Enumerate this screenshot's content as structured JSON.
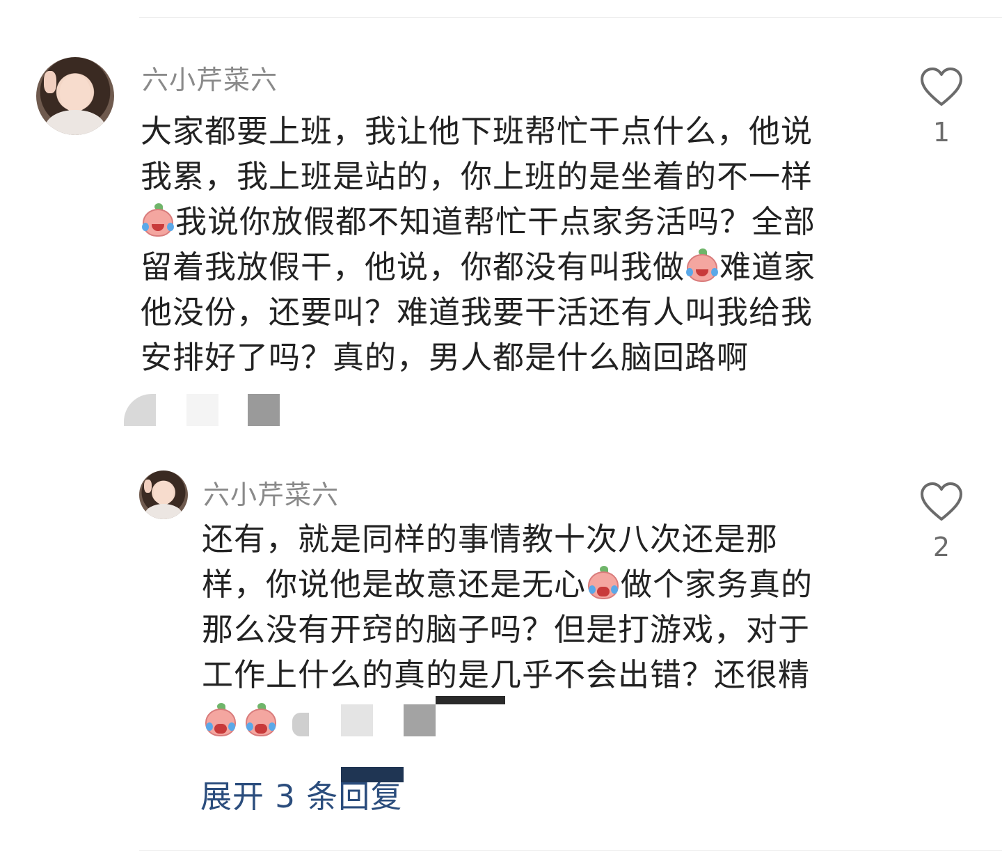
{
  "comments": [
    {
      "username": "六小芹菜六",
      "text_parts": [
        "大家都要上班，我让他下班帮忙干点什么，他说\n我累，我上班是站的，你上班的是坐着的不一样\n",
        "我说你放假都不知道帮忙干点家务活吗？全部\n留着我放假干，他说，你都没有叫我做",
        "难道家\n他没份，还要叫？难道我要干活还有人叫我给我\n安排好了吗？真的，男人都是什么脑回路啊"
      ],
      "emojis": [
        "crying-laughing-emoji",
        "crying-laughing-emoji"
      ],
      "likes": "1"
    },
    {
      "username": "六小芹菜六",
      "text_parts": [
        "还有，就是同样的事情教十次八次还是那\n样，你说他是故意还是无心",
        "做个家务真的\n那么没有开窍的脑子吗？但是打游戏，对于\n工作上什么的真的是几乎不会出错？还很精\n"
      ],
      "emojis": [
        "angry-crying-emoji",
        "angry-crying-emoji",
        "angry-crying-emoji"
      ],
      "likes": "2"
    }
  ],
  "expand_replies_label": "展开 3 条回复",
  "colors": {
    "username": "#8a8a8a",
    "text": "#222222",
    "link": "#2b4d7d",
    "like_icon": "#6b6b6b"
  }
}
